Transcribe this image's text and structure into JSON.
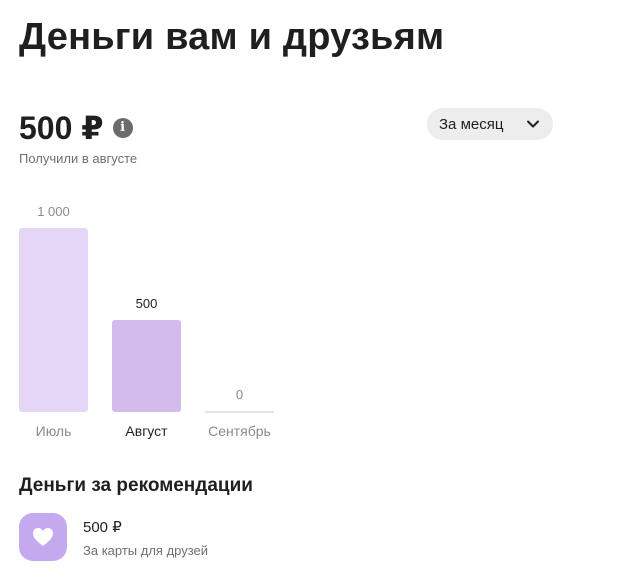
{
  "page": {
    "title": "Деньги вам и друзьям"
  },
  "summary": {
    "amount": "500 ₽",
    "info_icon": "info-icon",
    "caption": "Получили в августе"
  },
  "period_select": {
    "selected": "За месяц",
    "icon": "chevron-down-icon"
  },
  "chart_data": {
    "type": "bar",
    "categories": [
      "Июль",
      "Август",
      "Сентябрь"
    ],
    "values": [
      1000,
      500,
      0
    ],
    "data_labels": [
      "1 000",
      "500",
      "0"
    ],
    "highlighted_index": 1,
    "colors": {
      "bar": "#e5d6f6",
      "bar_highlight": "#d3bbee",
      "empty_line": "#e4e4e4",
      "label_muted": "#8a8a8a",
      "label_active": "#1f1f1f"
    },
    "title": "",
    "xlabel": "",
    "ylabel": "",
    "ylim": [
      0,
      1000
    ],
    "grid": false
  },
  "rewards": {
    "title": "Деньги за рекомендации",
    "items": [
      {
        "amount": "500 ₽",
        "description": "За карты для друзей",
        "icon": "heart-icon",
        "icon_color": "#c4a9ef"
      }
    ]
  }
}
